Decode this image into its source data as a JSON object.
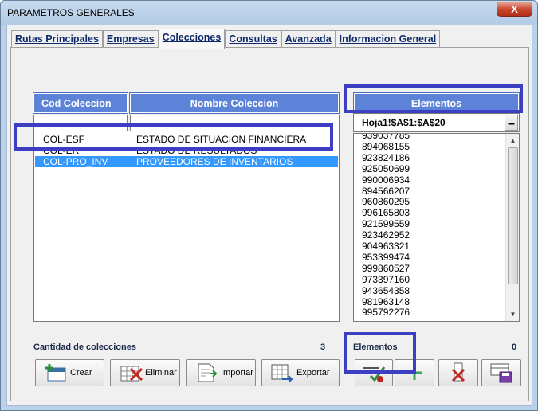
{
  "window": {
    "title": "PARAMETROS GENERALES",
    "close_label": "X"
  },
  "tabs": [
    {
      "label": "Rutas Principales",
      "active": false
    },
    {
      "label": "Empresas",
      "active": false
    },
    {
      "label": "Colecciones",
      "active": true
    },
    {
      "label": "Consultas",
      "active": false
    },
    {
      "label": "Avanzada",
      "active": false
    },
    {
      "label": "Informacion General",
      "active": false
    }
  ],
  "collections_table": {
    "columns": [
      "Cod Coleccion",
      "Nombre Coleccion"
    ],
    "rows": [
      {
        "code": "COL-ESF",
        "name": "ESTADO DE SITUACION FINANCIERA",
        "selected": false
      },
      {
        "code": "COL-ER",
        "name": "ESTADO DE RESULTADOS",
        "selected": false
      },
      {
        "code": "COL-PRO_INV",
        "name": "PROVEEDORES DE INVENTARIOS",
        "selected": true
      }
    ],
    "count_label": "Cantidad de colecciones",
    "count_value": "3"
  },
  "elements": {
    "header": "Elementos",
    "range_value": "Hoja1!$A$1:$A$20",
    "items": [
      "939037785",
      "894068155",
      "923824186",
      "925050699",
      "990006934",
      "894566207",
      "960860295",
      "996165803",
      "921599559",
      "923462952",
      "904963321",
      "953399474",
      "999860527",
      "973397160",
      "943654358",
      "981963148",
      "995792276"
    ],
    "count_label": "Elementos",
    "count_value": "0"
  },
  "buttons": {
    "crear": "Crear",
    "eliminar": "Eliminar",
    "importar": "Importar",
    "exportar": "Exportar"
  },
  "colors": {
    "header_blue": "#5d83d8",
    "selection_blue": "#3399ff",
    "highlight_box": "#3c3fc2"
  }
}
